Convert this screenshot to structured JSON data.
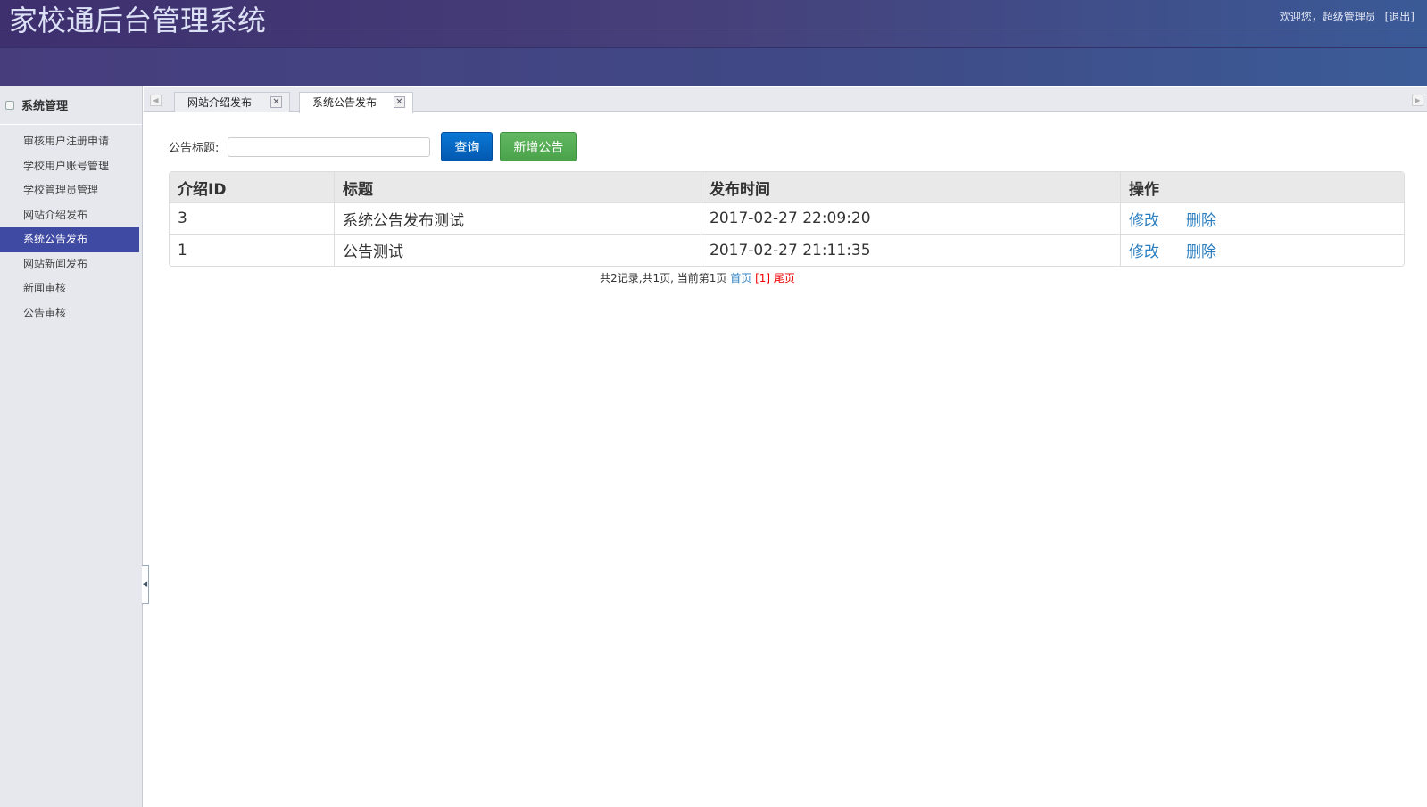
{
  "header": {
    "title": "家校通后台管理系统",
    "welcome": "欢迎您，超级管理员",
    "logout": "[退出]"
  },
  "sidebar": {
    "group": "系统管理",
    "items": [
      {
        "label": "审核用户注册申请"
      },
      {
        "label": "学校用户账号管理"
      },
      {
        "label": "学校管理员管理"
      },
      {
        "label": "网站介绍发布"
      },
      {
        "label": "系统公告发布",
        "active": true
      },
      {
        "label": "网站新闻发布"
      },
      {
        "label": "新闻审核"
      },
      {
        "label": "公告审核"
      }
    ]
  },
  "tabs": [
    {
      "label": "网站介绍发布"
    },
    {
      "label": "系统公告发布",
      "active": true
    }
  ],
  "search": {
    "label": "公告标题:",
    "value": "",
    "query_btn": "查询",
    "add_btn": "新增公告"
  },
  "table": {
    "headers": [
      "介绍ID",
      "标题",
      "发布时间",
      "操作"
    ],
    "rows": [
      {
        "id": "3",
        "title": "系统公告发布测试",
        "time": "2017-02-27 22:09:20",
        "edit": "修改",
        "del": "删除"
      },
      {
        "id": "1",
        "title": "公告测试",
        "time": "2017-02-27 21:11:35",
        "edit": "修改",
        "del": "删除"
      }
    ]
  },
  "pager": {
    "summary": "共2记录,共1页, 当前第1页",
    "first": "首页",
    "current": "[1]",
    "last": "尾页"
  }
}
